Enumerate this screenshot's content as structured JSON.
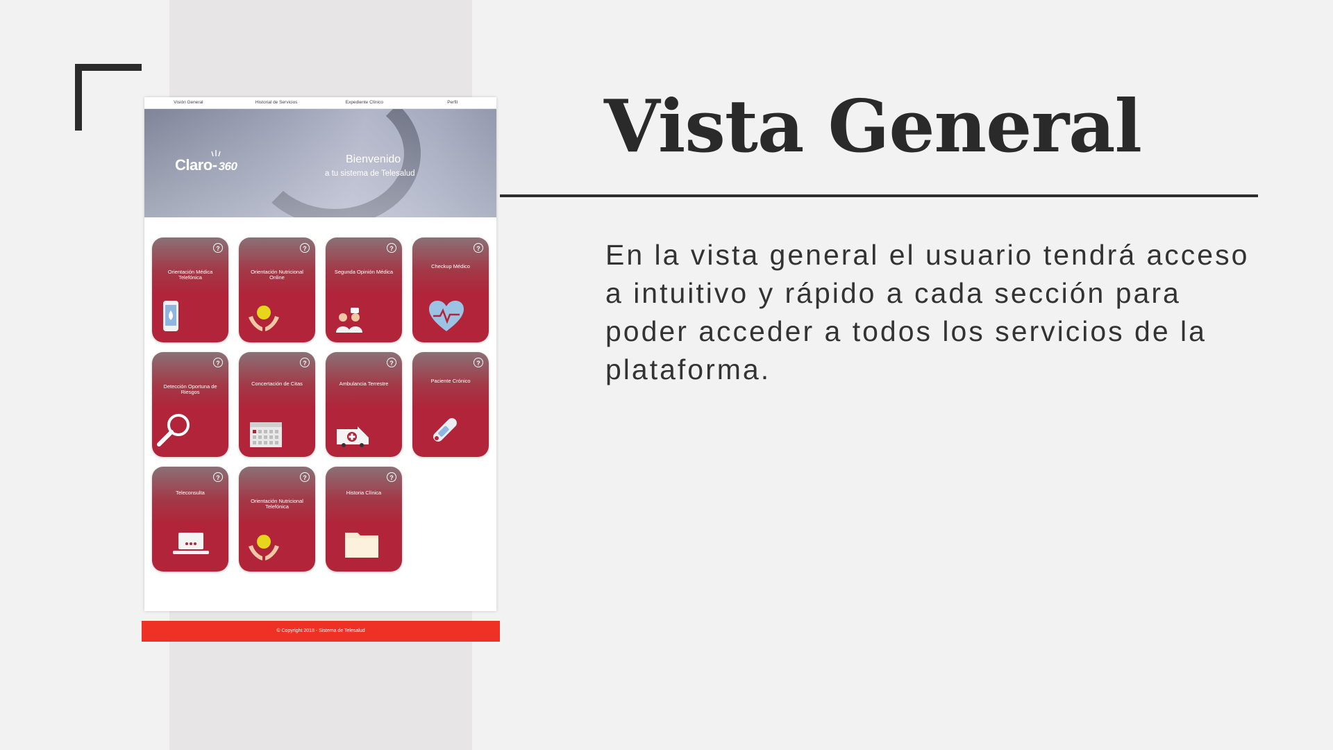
{
  "slide": {
    "title": "Vista General",
    "description": "En la vista general el usuario tendrá acceso a intuitivo y rápido a cada sección para poder acceder a todos los servicios de la plataforma."
  },
  "app": {
    "nav": [
      "Visión General",
      "Historial de Servicios",
      "Expediente Clínico",
      "Perfil"
    ],
    "brand": {
      "name": "Claro",
      "suffix": "360"
    },
    "hero": {
      "title": "Bienvenido",
      "subtitle": "a tu sistema de Telesalud"
    },
    "help_glyph": "?",
    "tiles": [
      {
        "label": "Orientación Médica Telefónica",
        "icon": "smartphone-icon"
      },
      {
        "label": "Orientación Nutricional Online",
        "icon": "apple-hands-icon"
      },
      {
        "label": "Segunda Opinión Médica",
        "icon": "doctors-icon"
      },
      {
        "label": "Checkup Médico",
        "icon": "heart-pulse-icon"
      },
      {
        "label": "Detección Oportuna de Riesgos",
        "icon": "magnifier-icon"
      },
      {
        "label": "Concertación de Citas",
        "icon": "calendar-icon"
      },
      {
        "label": "Ambulancia Terrestre",
        "icon": "ambulance-icon"
      },
      {
        "label": "Paciente Crónico",
        "icon": "thermometer-icon"
      },
      {
        "label": "Teleconsulta",
        "icon": "laptop-icon"
      },
      {
        "label": "Orientación Nutricional Telefónica",
        "icon": "apple-hands-icon"
      },
      {
        "label": "Historia Clínica",
        "icon": "folder-icon"
      }
    ],
    "footer": "© Copyright 2018 - Sistema de Telesalud"
  },
  "colors": {
    "tile_red": "#b1243a",
    "footer_red": "#ee3124",
    "ink": "#2a2a2a",
    "background": "#f1f2f1"
  }
}
